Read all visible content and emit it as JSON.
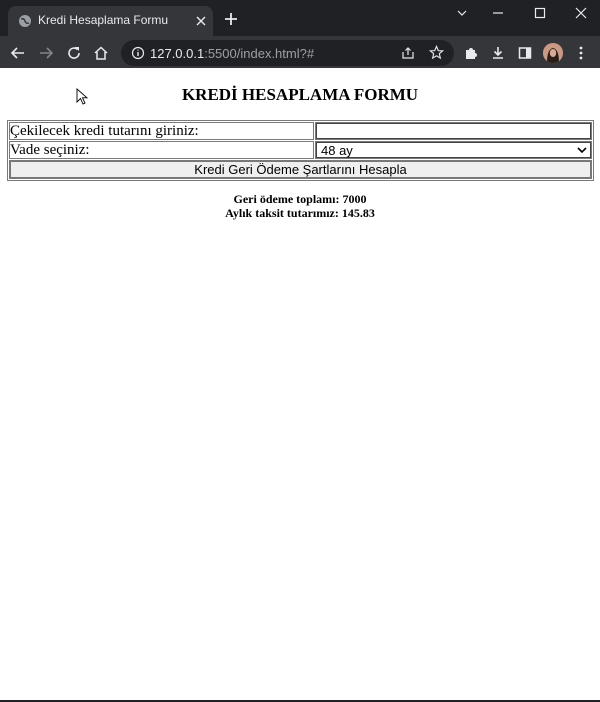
{
  "browser": {
    "tab_title": "Kredi Hesaplama Formu",
    "url_host": "127.0.0.1",
    "url_rest": ":5500/index.html?#"
  },
  "icons": {
    "favicon": "globe-icon",
    "tab_close": "close-icon",
    "new_tab": "plus-icon",
    "back": "back-arrow-icon",
    "forward": "forward-arrow-icon",
    "reload": "reload-icon",
    "home": "home-icon",
    "site_info": "info-icon",
    "share": "share-icon",
    "bookmark": "star-icon",
    "extensions": "puzzle-icon",
    "downloads": "download-icon",
    "side_panel": "side-panel-icon",
    "menu": "kebab-menu-icon"
  },
  "page": {
    "title": "KREDİ HESAPLAMA FORMU",
    "amount_label": "Çekilecek kredi tutarını giriniz:",
    "amount_value": "",
    "term_label": "Vade seçiniz:",
    "term_selected": "48 ay",
    "calc_button": "Kredi Geri Ödeme Şartlarını Hesapla",
    "result_total": "Geri ödeme toplamı: 7000",
    "result_installment": "Aylık taksit tutarımız: 145.83"
  },
  "colors": {
    "chrome_dark": "#202124",
    "chrome_tab": "#35363a",
    "text_light": "#e8eaed"
  }
}
